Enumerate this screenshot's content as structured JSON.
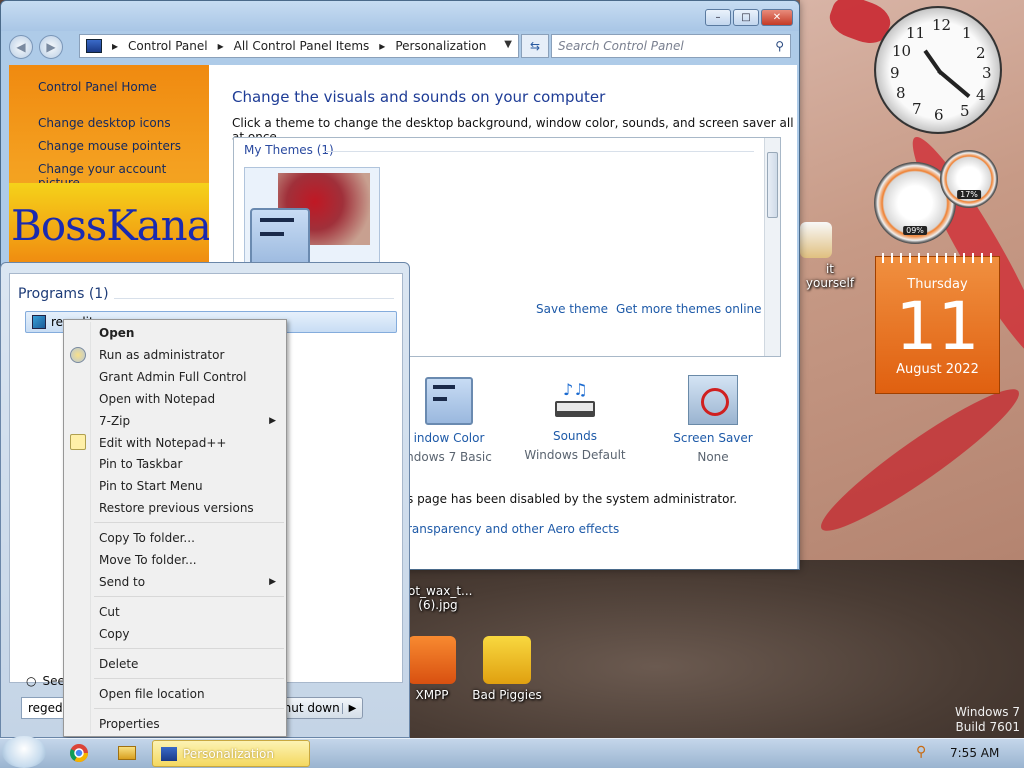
{
  "window": {
    "buttons": {
      "minimize": "–",
      "maximize": "□",
      "close": "✕"
    },
    "breadcrumb": [
      "Control Panel",
      "All Control Panel Items",
      "Personalization"
    ],
    "search_placeholder": "Search Control Panel"
  },
  "sidebar": {
    "home": "Control Panel Home",
    "links": [
      "Change desktop icons",
      "Change mouse pointers",
      "Change your account picture"
    ],
    "banner": "BossKanae"
  },
  "content": {
    "title": "Change the visuals and sounds on your computer",
    "subtitle": "Click a theme to change the desktop background, window color, sounds, and screen saver all at once.",
    "my_themes": "My Themes (1)",
    "save_theme": "Save theme",
    "more_themes": "Get more themes online",
    "window_color": {
      "label": "indow Color",
      "sub": "ndows 7 Basic"
    },
    "sounds": {
      "label": "Sounds",
      "sub": "Windows Default"
    },
    "screen_saver": {
      "label": "Screen Saver",
      "sub": "None"
    },
    "disabled_text": "s page has been disabled by the system administrator.",
    "aero_link": "ransparency and other Aero effects"
  },
  "startmenu": {
    "programs_header": "Programs (1)",
    "program_item": "regedit.exe",
    "see_more": "See more results",
    "search_value": "regedit",
    "shutdown": "Shut down"
  },
  "context_menu": {
    "open": "Open",
    "run_admin": "Run as administrator",
    "grant": "Grant Admin Full Control",
    "notepad": "Open with Notepad",
    "zip": "7-Zip",
    "notepadpp": "Edit with Notepad++",
    "pin_taskbar": "Pin to Taskbar",
    "pin_start": "Pin to Start Menu",
    "restore": "Restore previous versions",
    "copy_to": "Copy To folder...",
    "move_to": "Move To folder...",
    "send_to": "Send to",
    "cut": "Cut",
    "copy": "Copy",
    "delete": "Delete",
    "open_location": "Open file location",
    "properties": "Properties"
  },
  "taskbar": {
    "task_label": "Personalization",
    "time": "7:55 AM"
  },
  "desktop": {
    "watermark_line1": "Windows 7",
    "watermark_line2": "Build 7601",
    "icons": {
      "xampp": "XMPP",
      "bad_piggies": "Bad Piggies",
      "jpg_line1": "ot_wax_t...",
      "jpg_line2": "(6).jpg",
      "diy": "it yourself"
    }
  },
  "gadgets": {
    "clock_numbers": [
      "12",
      "1",
      "2",
      "3",
      "4",
      "5",
      "6",
      "7",
      "8",
      "9",
      "10",
      "11"
    ],
    "cpu_pct": "09%",
    "mem_pct": "17%",
    "cal_day": "Thursday",
    "cal_num": "11",
    "cal_month_year": "August 2022"
  }
}
